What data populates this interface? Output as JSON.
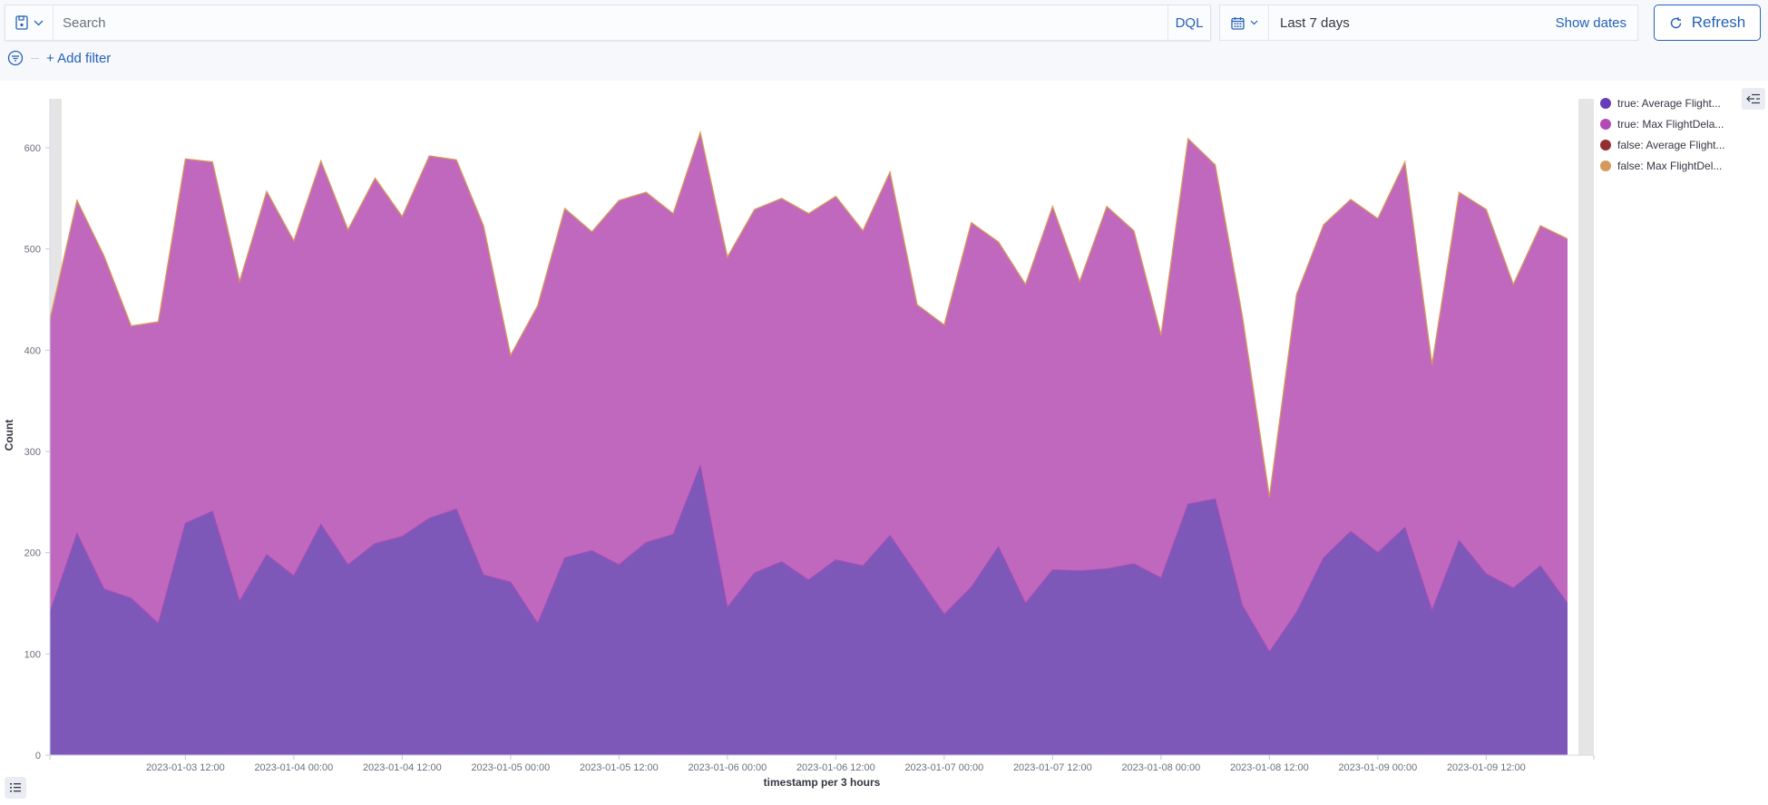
{
  "query_bar": {
    "search_placeholder": "Search",
    "language": "DQL",
    "save_icon": "save-icon"
  },
  "date_picker": {
    "range": "Last 7 days",
    "show_dates": "Show dates"
  },
  "refresh_label": "Refresh",
  "filter": {
    "add_filter": "+ Add filter"
  },
  "legend": [
    {
      "label": "true: Average Flight...",
      "color": "#6a3db8"
    },
    {
      "label": "true: Max FlightDela...",
      "color": "#b24ab6"
    },
    {
      "label": "false: Average Flight...",
      "color": "#932f30"
    },
    {
      "label": "false: Max FlightDel...",
      "color": "#d6995c"
    }
  ],
  "chart_data": {
    "type": "area",
    "stacked": true,
    "ylabel": "Count",
    "xlabel": "timestamp per 3 hours",
    "ylim": [
      0,
      650
    ],
    "yticks": [
      0,
      100,
      200,
      300,
      400,
      500,
      600
    ],
    "x_start": "2023-01-02 21:00",
    "x_interval_hours": 3,
    "xtick_labels": [
      "2023-01-03 12:00",
      "2023-01-04 00:00",
      "2023-01-04 12:00",
      "2023-01-05 00:00",
      "2023-01-05 12:00",
      "2023-01-06 00:00",
      "2023-01-06 12:00",
      "2023-01-07 00:00",
      "2023-01-07 12:00",
      "2023-01-08 00:00",
      "2023-01-08 12:00",
      "2023-01-09 00:00",
      "2023-01-09 12:00"
    ],
    "series": [
      {
        "name": "true: Average FlightDelayMin",
        "color": "#7e58b9",
        "values": [
          141,
          219,
          164,
          155,
          130,
          229,
          241,
          152,
          198,
          177,
          228,
          188,
          209,
          216,
          234,
          243,
          178,
          171,
          130,
          195,
          202,
          188,
          210,
          218,
          286,
          146,
          180,
          191,
          173,
          193,
          187,
          217,
          178,
          139,
          166,
          206,
          150,
          183,
          182,
          184,
          189,
          175,
          248,
          253,
          148,
          102,
          141,
          195,
          221,
          200,
          225,
          143,
          212,
          179,
          165,
          187,
          150
        ]
      },
      {
        "name": "true: Max FlightDelayMin",
        "color": "#c068bd",
        "values": [
          289,
          329,
          329,
          269,
          298,
          360,
          345,
          316,
          359,
          331,
          359,
          331,
          361,
          316,
          358,
          345,
          345,
          224,
          314,
          345,
          315,
          360,
          346,
          317,
          329,
          346,
          359,
          359,
          362,
          359,
          331,
          359,
          267,
          286,
          360,
          301,
          315,
          359,
          286,
          358,
          329,
          240,
          361,
          330,
          286,
          153,
          314,
          329,
          328,
          330,
          361,
          243,
          344,
          360,
          300,
          336,
          360
        ]
      },
      {
        "name": "false: Average FlightDelayMin",
        "color": "#932f30",
        "values": []
      },
      {
        "name": "false: Max FlightDelayMin",
        "color": "#d6995c",
        "values": []
      }
    ]
  }
}
